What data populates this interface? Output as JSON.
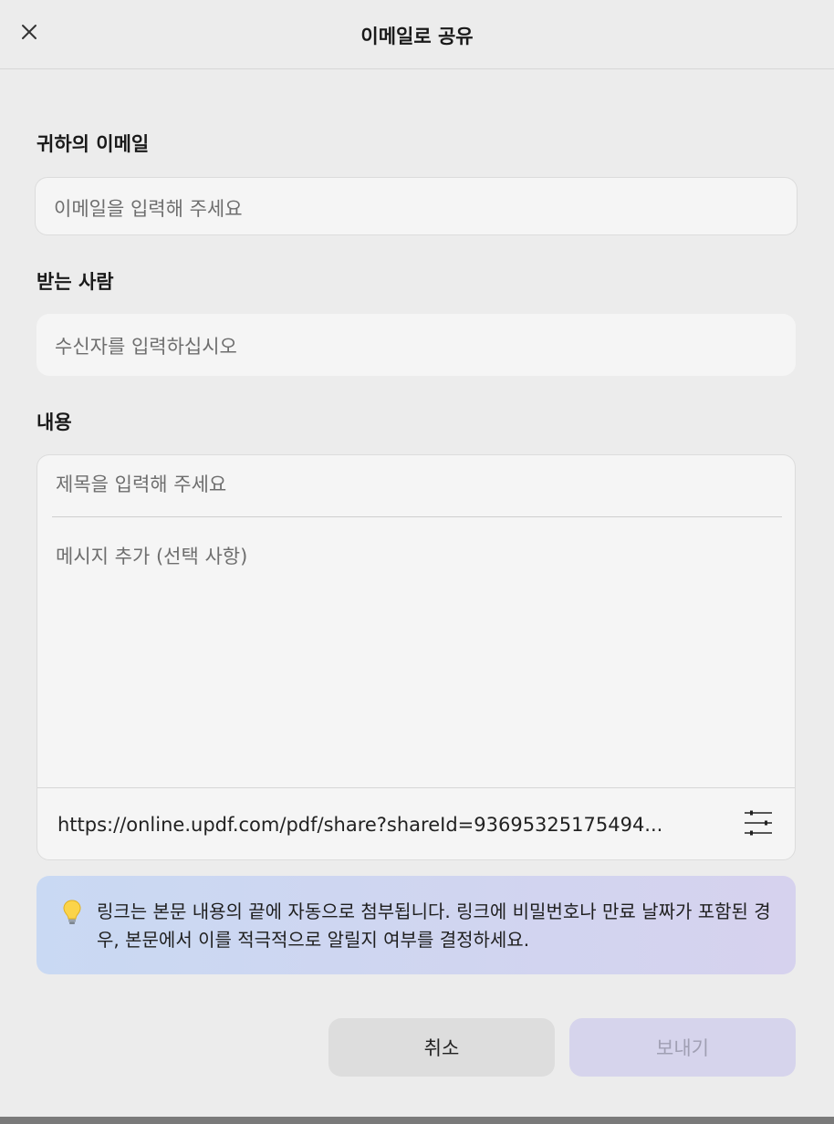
{
  "dialog": {
    "title": "이메일로 공유",
    "close_icon": "close-icon"
  },
  "sender": {
    "label": "귀하의 이메일",
    "placeholder": "이메일을 입력해 주세요",
    "value": ""
  },
  "recipient": {
    "label": "받는 사람",
    "placeholder": "수신자를 입력하십시오",
    "value": ""
  },
  "content": {
    "label": "내용",
    "subject_placeholder": "제목을 입력해 주세요",
    "message_placeholder": "메시지 추가 (선택 사항)",
    "link": "https://online.updf.com/pdf/share?shareId=93695325175494...",
    "settings_icon": "sliders-icon"
  },
  "notice": {
    "icon": "lightbulb-icon",
    "text": "링크는 본문 내용의 끝에 자동으로 첨부됩니다. 링크에 비밀번호나 만료 날짜가 포함된 경우, 본문에서 이를 적극적으로 알릴지 여부를 결정하세요."
  },
  "actions": {
    "cancel_label": "취소",
    "send_label": "보내기"
  },
  "colors": {
    "background": "#ececec",
    "field_bg": "#f5f5f5",
    "notice_gradient_start": "#c9d9f3",
    "notice_gradient_end": "#d6d2ee",
    "send_disabled_bg": "#d6d4ec",
    "send_disabled_text": "#a09fb3"
  }
}
